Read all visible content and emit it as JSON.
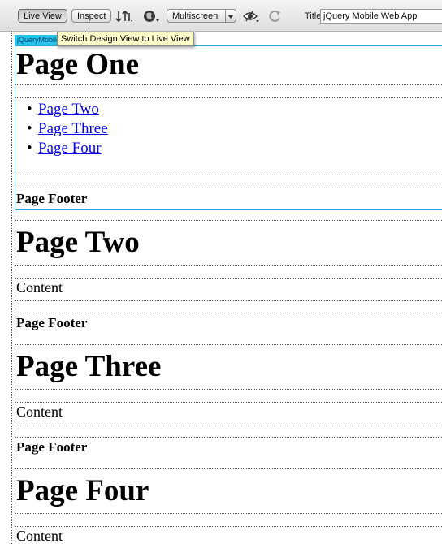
{
  "toolbar": {
    "live_view_label": "Live View",
    "inspect_label": "Inspect",
    "multiscreen_label": "Multiscreen",
    "title_label": "Title:",
    "title_value": "jQuery Mobile Web App",
    "icons": [
      "file-management-icon",
      "preview-globe-icon",
      "multiscreen-dropdown-icon",
      "visual-aids-icon",
      "refresh-icon"
    ]
  },
  "canvas": {
    "element_tag": "jQueryMobile",
    "tooltip": "Switch Design View to Live View",
    "pages": [
      {
        "heading": "Page One",
        "links": [
          "Page Two",
          "Page Three",
          "Page Four"
        ],
        "footer": "Page Footer"
      },
      {
        "heading": "Page Two",
        "content": "Content",
        "footer": "Page Footer"
      },
      {
        "heading": "Page Three",
        "content": "Content",
        "footer": "Page Footer"
      },
      {
        "heading": "Page Four",
        "content": "Content"
      }
    ]
  },
  "colors": {
    "selection_border": "#2aa6d6",
    "element_tag_bg": "#29c4ef",
    "tooltip_bg": "#fefdc8",
    "link": "#0000ee"
  }
}
